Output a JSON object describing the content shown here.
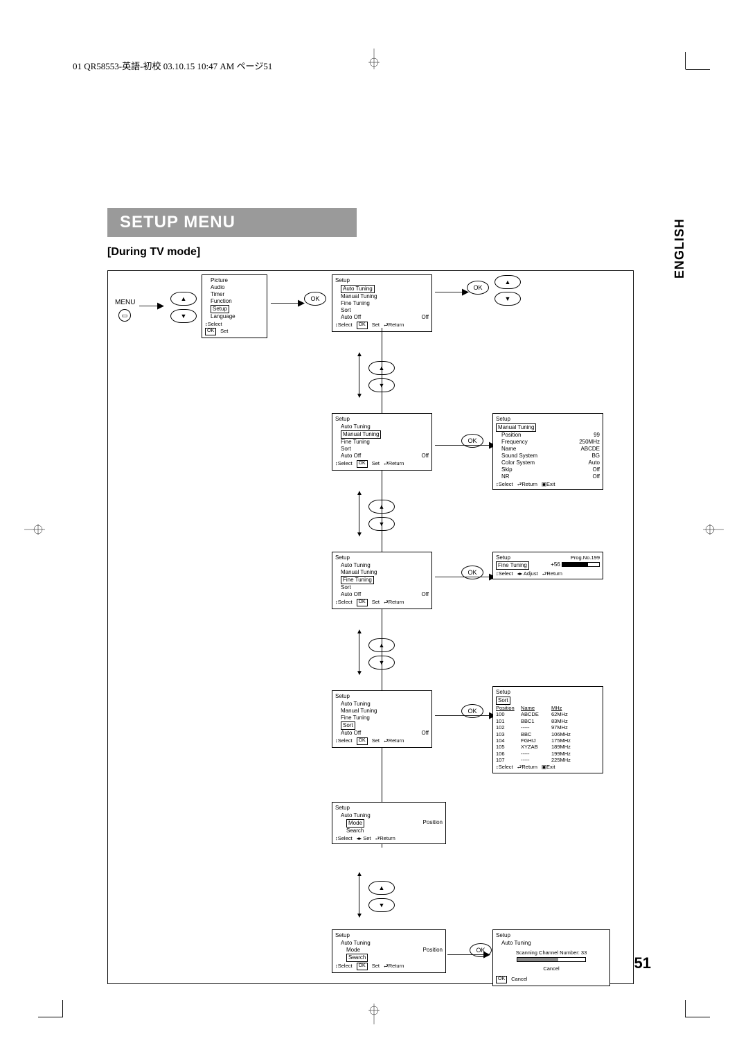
{
  "header": "01 QR58553-英語-初校  03.10.15  10:47 AM  ページ51",
  "title": "SETUP MENU",
  "subtitle": "[During TV mode]",
  "lang_tab": "ENGLISH",
  "page_number": "51",
  "labels": {
    "menu": "MENU",
    "ok": "OK",
    "select": "Select",
    "set": "Set",
    "return": "Return",
    "exit": "Exit",
    "adjust": "Adjust",
    "cancel": "Cancel"
  },
  "main_menu": {
    "title": "",
    "items": [
      "Picture",
      "Audio",
      "Timer",
      "Function",
      "Setup",
      "Language"
    ],
    "highlight": "Setup",
    "hints": [
      "↕ Select",
      "OK Set"
    ]
  },
  "setup_menu": {
    "title": "Setup",
    "items": [
      {
        "label": "Auto Tuning"
      },
      {
        "label": "Manual Tuning"
      },
      {
        "label": "Fine Tuning"
      },
      {
        "label": "Sort"
      },
      {
        "label": "Auto Off",
        "value": "Off"
      }
    ],
    "hints": [
      "↕ Select",
      "OK Set",
      "⮐ Return"
    ]
  },
  "setup_hl": [
    "Auto Tuning",
    "Manual Tuning",
    "Fine Tuning",
    "Sort"
  ],
  "manual_tuning": {
    "title": "Setup",
    "hl": "Manual Tuning",
    "rows": [
      {
        "l": "Position",
        "v": "99"
      },
      {
        "l": "Frequency",
        "v": "250MHz"
      },
      {
        "l": "Name",
        "v": "ABCDE"
      },
      {
        "l": "Sound System",
        "v": "BG"
      },
      {
        "l": "Color System",
        "v": "Auto"
      },
      {
        "l": "Skip",
        "v": "Off"
      },
      {
        "l": "NR",
        "v": "Off"
      }
    ],
    "hints": [
      "↕ Select",
      "⮐ Return",
      "▣ Exit"
    ]
  },
  "fine_tuning": {
    "title": "Setup",
    "hl": "Fine Tuning",
    "prog": "Prog.No.199",
    "value": "+56",
    "hints": [
      "↕ Select",
      "◂▸ Adjust",
      "⮐ Return"
    ]
  },
  "sort": {
    "title": "Setup",
    "hl": "Sort",
    "cols": [
      "Position",
      "Name",
      "MHz"
    ],
    "rows": [
      [
        "100",
        "ABCDE",
        "62MHz"
      ],
      [
        "101",
        "BBC1",
        "83MHz"
      ],
      [
        "102",
        "-----",
        "97MHz"
      ],
      [
        "103",
        "BBC",
        "106MHz"
      ],
      [
        "104",
        "FGHIJ",
        "175MHz"
      ],
      [
        "105",
        "XYZAB",
        "189MHz"
      ],
      [
        "106",
        "-----",
        "199MHz"
      ],
      [
        "107",
        "-----",
        "225MHz"
      ]
    ],
    "hints": [
      "↕ Select",
      "⮐ Return",
      "▣ Exit"
    ]
  },
  "auto_tuning_mode": {
    "title": "Setup",
    "sub": "Auto Tuning",
    "rows": [
      {
        "l": "Mode",
        "v": "Position",
        "hl": true
      },
      {
        "l": "Search",
        "v": ""
      }
    ],
    "hints": [
      "↕ Select",
      "◂▸ Set",
      "⮐ Return"
    ]
  },
  "auto_tuning_search": {
    "title": "Setup",
    "sub": "Auto Tuning",
    "rows": [
      {
        "l": "Mode",
        "v": "Position"
      },
      {
        "l": "Search",
        "v": "",
        "hl": true
      }
    ],
    "hints": [
      "↕ Select",
      "OK Set",
      "⮐ Return"
    ]
  },
  "scanning": {
    "title": "Setup",
    "sub": "Auto Tuning",
    "msg": "Scanning Channel Number: 33",
    "pct": 60,
    "cancel": "Cancel",
    "hint": "OK Cancel"
  }
}
